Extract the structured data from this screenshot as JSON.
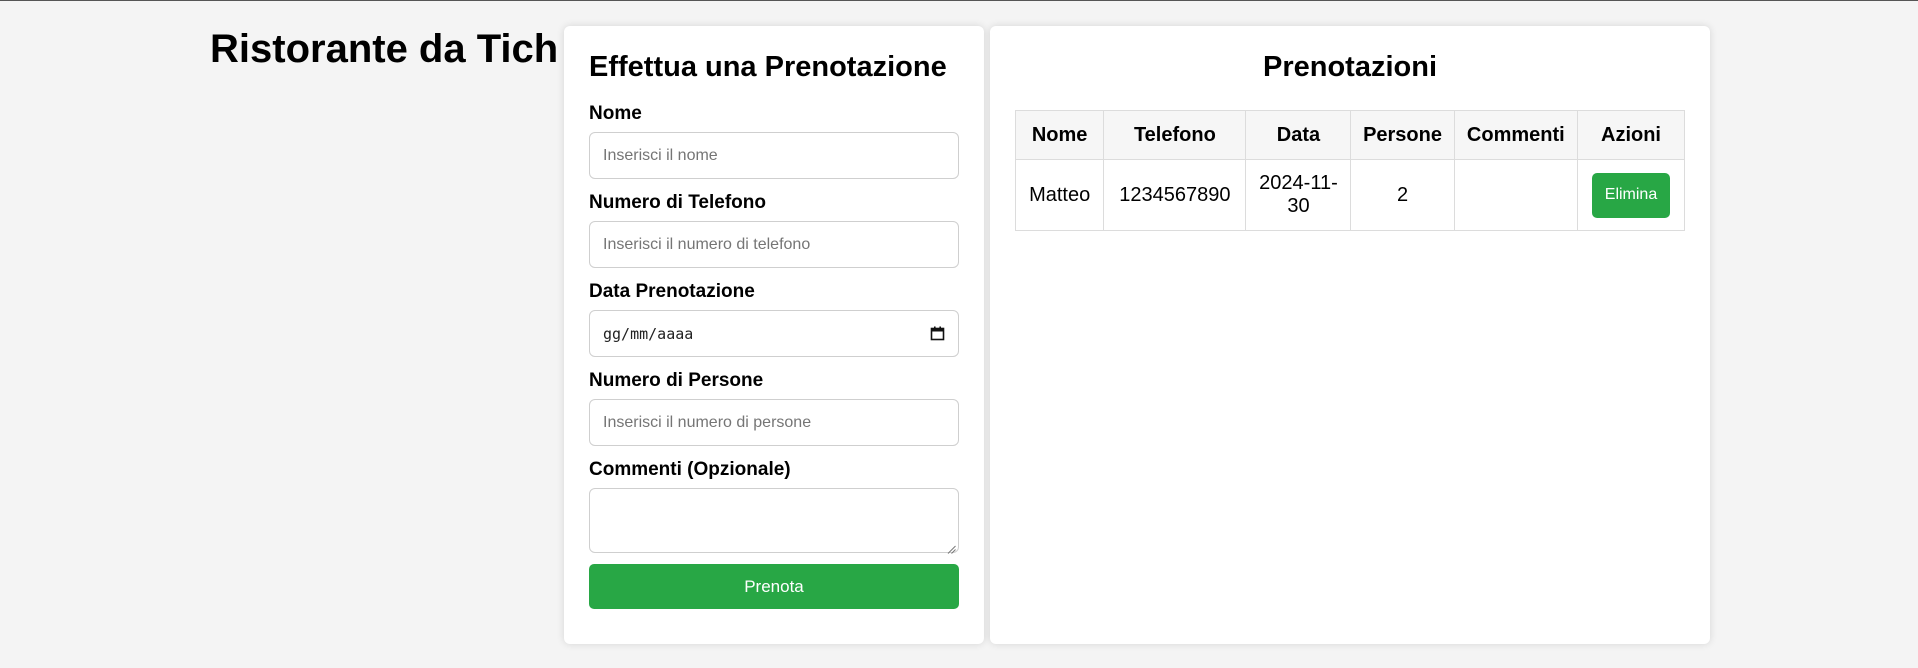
{
  "site": {
    "title": "Ristorante da Tichetti"
  },
  "form": {
    "title": "Effettua una Prenotazione",
    "fields": {
      "name": {
        "label": "Nome",
        "placeholder": "Inserisci il nome",
        "value": ""
      },
      "phone": {
        "label": "Numero di Telefono",
        "placeholder": "Inserisci il numero di telefono",
        "value": ""
      },
      "date": {
        "label": "Data Prenotazione",
        "placeholder": "gg/mm/aaaa",
        "value": ""
      },
      "people": {
        "label": "Numero di Persone",
        "placeholder": "Inserisci il numero di persone",
        "value": ""
      },
      "comments": {
        "label": "Commenti (Opzionale)",
        "value": ""
      }
    },
    "submit_label": "Prenota"
  },
  "bookings": {
    "title": "Prenotazioni",
    "columns": [
      "Nome",
      "Telefono",
      "Data",
      "Persone",
      "Commenti",
      "Azioni"
    ],
    "rows": [
      {
        "name": "Matteo",
        "phone": "1234567890",
        "date": "2024-11-30",
        "people": "2",
        "comments": "",
        "action_label": "Elimina"
      }
    ]
  },
  "colors": {
    "accent": "#28a745",
    "background": "#f4f4f4",
    "card": "#ffffff",
    "border": "#dcdcdc"
  }
}
